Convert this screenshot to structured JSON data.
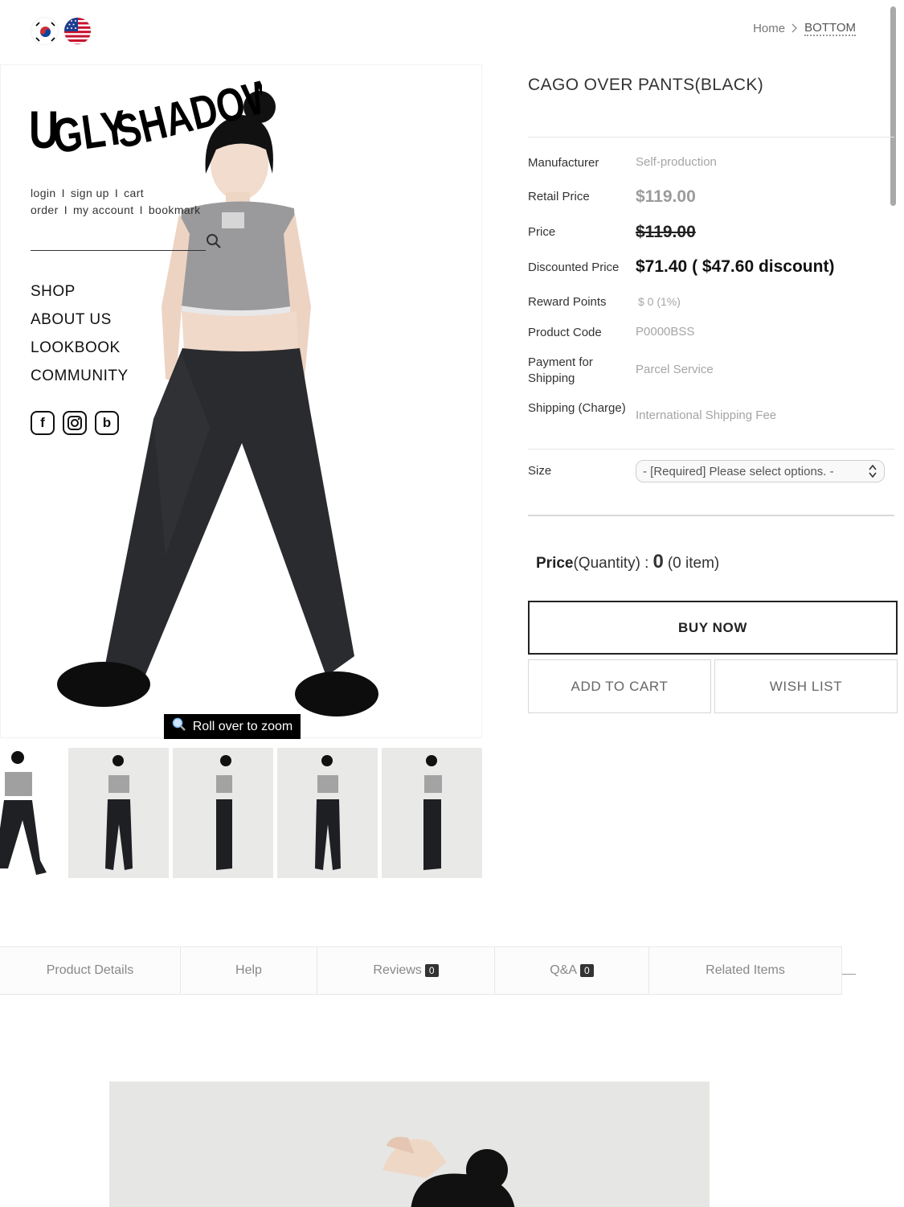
{
  "flags": [
    {
      "name": "korean-flag-icon"
    },
    {
      "name": "us-flag-icon"
    }
  ],
  "breadcrumb": {
    "home": "Home",
    "separator": ">",
    "current": "BOTTOM"
  },
  "brand": {
    "logo_text": "UGLY SHADOW"
  },
  "account_links": {
    "login": "login",
    "sign_up": "sign up",
    "cart": "cart",
    "order": "order",
    "my_account": "my account",
    "bookmark": "bookmark",
    "separator": "I"
  },
  "search": {
    "placeholder": "",
    "value": ""
  },
  "nav": {
    "items": [
      "SHOP",
      "ABOUT US",
      "LOOKBOOK",
      "COMMUNITY"
    ]
  },
  "social": [
    {
      "label": "f",
      "icon": "facebook-icon"
    },
    {
      "label": "instagram",
      "icon": "instagram-icon"
    },
    {
      "label": "b",
      "icon": "blog-icon"
    }
  ],
  "zoom_tip": "Roll over to zoom",
  "product": {
    "title": "CAGO OVER PANTS(BLACK)",
    "specs": {
      "manufacturer_label": "Manufacturer",
      "manufacturer_value": "Self-production",
      "retail_price_label": "Retail Price",
      "retail_price_value": "$119.00",
      "price_label": "Price",
      "price_value": "$119.00",
      "discounted_label": "Discounted Price",
      "discounted_value": "$71.40 ( $47.60 discount)",
      "reward_label": "Reward Points",
      "reward_value": "$ 0 (1%)",
      "code_label": "Product Code",
      "code_value": "P0000BSS",
      "payment_label": "Payment for Shipping",
      "payment_value": "Parcel Service",
      "shipping_label": "Shipping (Charge)",
      "shipping_value": "International Shipping Fee"
    },
    "size_label": "Size",
    "size_select": "- [Required] Please select options. -",
    "price_quantity": {
      "label": "Price",
      "suffix": "(Quantity) :",
      "value": "0",
      "items": "(0 item)"
    },
    "buttons": {
      "buy_now": "BUY NOW",
      "add_to_cart": "ADD TO CART",
      "wish_list": "WISH LIST"
    }
  },
  "tabs": [
    {
      "label": "Product Details"
    },
    {
      "label": "Help"
    },
    {
      "label": "Reviews",
      "count": "0"
    },
    {
      "label": "Q&A",
      "count": "0"
    },
    {
      "label": "Related Items"
    }
  ],
  "colors": {
    "accent": "#222222",
    "muted_text": "#a5a5a5",
    "tab_badge": "#333333",
    "photo_background": "#e6e6e4"
  }
}
